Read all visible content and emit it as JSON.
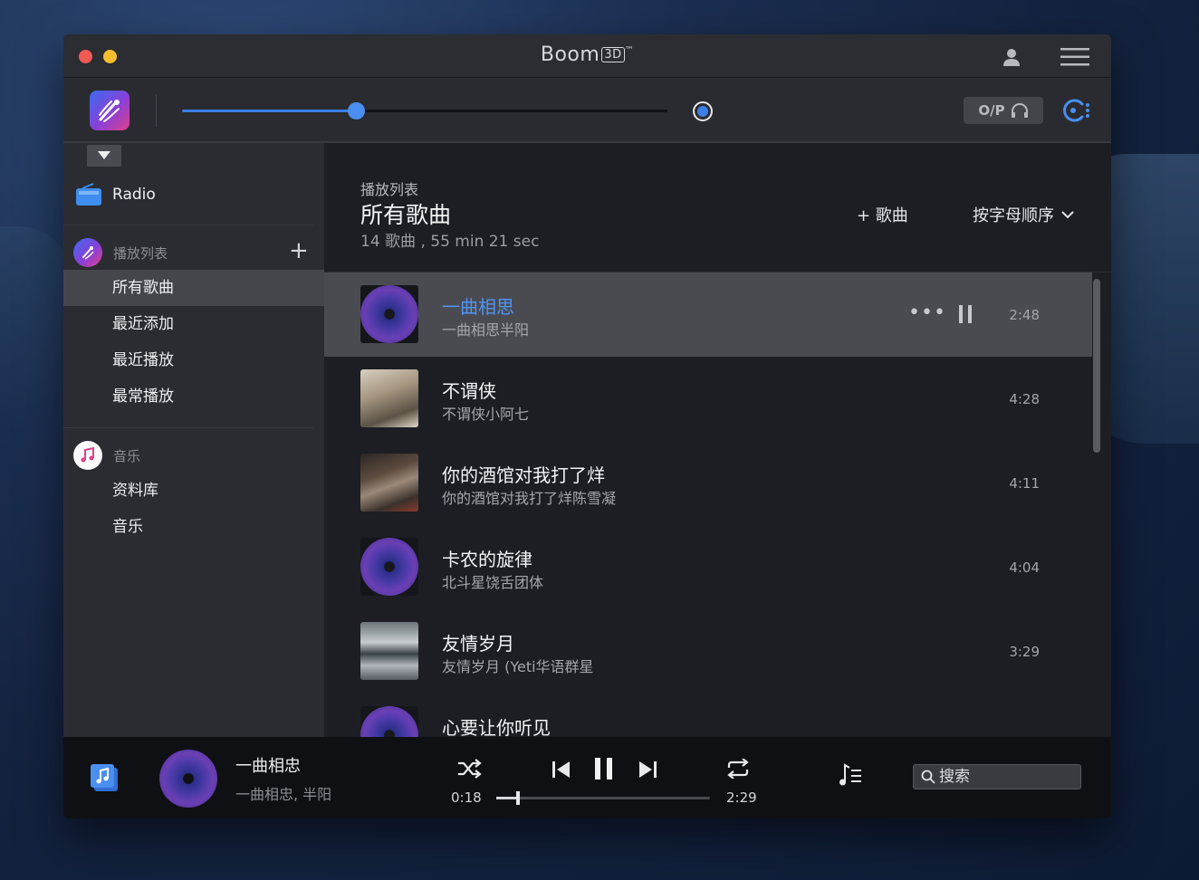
{
  "window": {
    "title": "Boom",
    "title_badge": "3D",
    "title_tm": "™"
  },
  "toolbar": {
    "volume_level": 0.36,
    "output_label": "O/P"
  },
  "sidebar": {
    "radio_label": "Radio",
    "playlists_label": "播放列表",
    "add_label": "+",
    "playlist_items": [
      {
        "label": "所有歌曲",
        "active": true
      },
      {
        "label": "最近添加",
        "active": false
      },
      {
        "label": "最近播放",
        "active": false
      },
      {
        "label": "最常播放",
        "active": false
      }
    ],
    "music_label": "音乐",
    "music_items": [
      {
        "label": "资料库"
      },
      {
        "label": "音乐"
      }
    ]
  },
  "main": {
    "caption": "播放列表",
    "title": "所有歌曲",
    "meta": "14 歌曲 , 55 min 21 sec",
    "add_song": "+ 歌曲",
    "sort_label": "按字母顺序"
  },
  "songs": [
    {
      "title": "一曲相思",
      "artist": "一曲相思半阳",
      "duration": "2:48",
      "playing": true,
      "cover": "disc"
    },
    {
      "title": "不谓侠",
      "artist": "不谓侠小阿七",
      "duration": "4:28",
      "playing": false,
      "cover": "photo1"
    },
    {
      "title": "你的酒馆对我打了烊",
      "artist": "你的酒馆对我打了烊陈雪凝",
      "duration": "4:11",
      "playing": false,
      "cover": "photo2"
    },
    {
      "title": "卡农的旋律",
      "artist": "北斗星饶舌团体",
      "duration": "4:04",
      "playing": false,
      "cover": "disc"
    },
    {
      "title": "友情岁月",
      "artist": "友情岁月 (Yeti华语群星",
      "duration": "3:29",
      "playing": false,
      "cover": "photo3"
    },
    {
      "title": "心要让你听见",
      "artist": "",
      "duration": "",
      "playing": false,
      "cover": "disc"
    }
  ],
  "player": {
    "now_title": "一曲相忠",
    "now_artist": "一曲相忠, 半阳",
    "elapsed": "0:18",
    "total": "2:29",
    "progress": 0.1,
    "search_placeholder": "搜索"
  },
  "colors": {
    "accent": "#4f94f5",
    "volume": "#3d7fe6",
    "close": "#f25a52",
    "minimize": "#f6bd2f"
  }
}
